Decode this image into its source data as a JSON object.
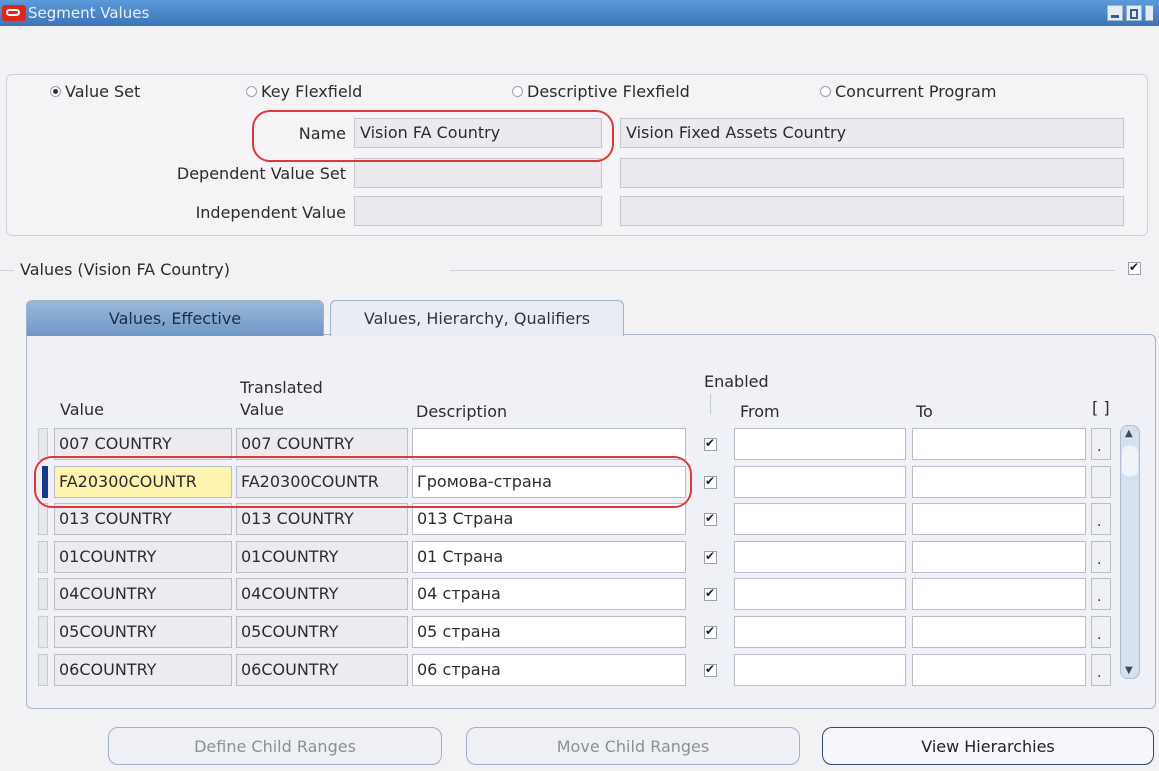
{
  "window": {
    "title": "Segment Values"
  },
  "radios": [
    {
      "label": "Value Set",
      "selected": true
    },
    {
      "label": "Key Flexfield",
      "selected": false
    },
    {
      "label": "Descriptive Flexfield",
      "selected": false
    },
    {
      "label": "Concurrent Program",
      "selected": false
    }
  ],
  "form": {
    "name_label": "Name",
    "name_value": "Vision FA Country",
    "name_description": "Vision Fixed Assets Country",
    "dependent_label": "Dependent Value Set",
    "dependent_value": "",
    "dependent_description": "",
    "independent_label": "Independent Value",
    "independent_value": "",
    "independent_description": ""
  },
  "values_section": {
    "title": "Values (Vision FA Country)",
    "checked": true
  },
  "tabs": [
    {
      "label": "Values, Effective",
      "active": true
    },
    {
      "label": "Values, Hierarchy, Qualifiers",
      "active": false
    }
  ],
  "table": {
    "headers": {
      "value": "Value",
      "translated_top": "Translated",
      "translated_bottom": "Value",
      "description": "Description",
      "enabled": "Enabled",
      "from": "From",
      "to": "To",
      "extra": "[ ]"
    },
    "rows": [
      {
        "value": "007 COUNTRY",
        "translated": "007 COUNTRY",
        "description": "",
        "enabled": true,
        "from": "",
        "to": ""
      },
      {
        "value": "FA20300COUNTR",
        "translated": "FA20300COUNTR",
        "description": "Громова-страна",
        "enabled": true,
        "from": "",
        "to": ""
      },
      {
        "value": "013 COUNTRY",
        "translated": "013 COUNTRY",
        "description": "013 Страна",
        "enabled": true,
        "from": "",
        "to": ""
      },
      {
        "value": "01COUNTRY",
        "translated": "01COUNTRY",
        "description": "01 Страна",
        "enabled": true,
        "from": "",
        "to": ""
      },
      {
        "value": "04COUNTRY",
        "translated": "04COUNTRY",
        "description": "04 страна",
        "enabled": true,
        "from": "",
        "to": ""
      },
      {
        "value": "05COUNTRY",
        "translated": "05COUNTRY",
        "description": "05 страна",
        "enabled": true,
        "from": "",
        "to": ""
      },
      {
        "value": "06COUNTRY",
        "translated": "06COUNTRY",
        "description": "06 страна",
        "enabled": true,
        "from": "",
        "to": ""
      }
    ]
  },
  "buttons": {
    "define": "Define Child Ranges",
    "move": "Move Child Ranges",
    "view": "View Hierarchies"
  },
  "colors": {
    "highlight_oval": "#e0383a",
    "active_cell": "#fff3b0",
    "titlebar": "#3b74b8"
  }
}
